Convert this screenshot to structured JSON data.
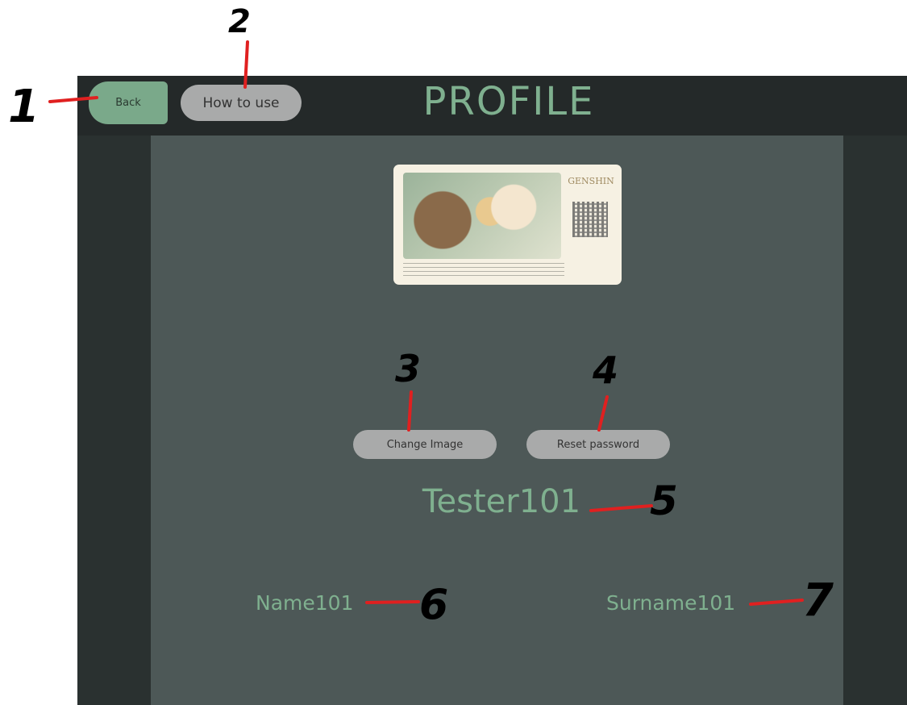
{
  "header": {
    "back_label": "Back",
    "howto_label": "How to use",
    "title": "PROFILE"
  },
  "card": {
    "logo_text": "GENSHIN"
  },
  "actions": {
    "change_image_label": "Change Image",
    "reset_password_label": "Reset password"
  },
  "profile": {
    "username": "Tester101",
    "name": "Name101",
    "surname": "Surname101"
  },
  "annotations": [
    "1",
    "2",
    "3",
    "4",
    "5",
    "6",
    "7"
  ],
  "colors": {
    "accent": "#7fb08f",
    "annotation_line": "#e02020"
  }
}
